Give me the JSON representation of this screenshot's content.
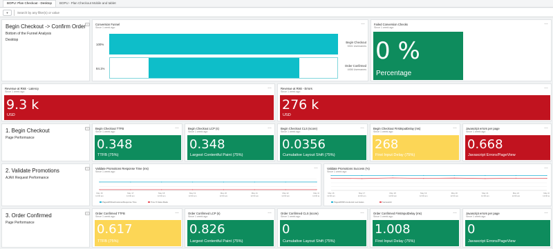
{
  "tabs": [
    {
      "label": "BOPU: Plan Checkout - Desktop",
      "active": true
    },
    {
      "label": "BOPU - Plan Checkout Mobile and tablet",
      "active": false
    }
  ],
  "filter": {
    "button_icon": "filter-icon",
    "placeholder": "Search by any filter(s) or value"
  },
  "sections": {
    "funnel": {
      "title": "Begin Checkout -> Confirm Order",
      "sub1": "Bottom of the Funnel Analysis",
      "sub2": "Desktop"
    },
    "begin": {
      "title": "1. Begin Checkout",
      "sub": "Page Performance"
    },
    "validate": {
      "title": "2. Validate Promotions",
      "sub": "AJAX Request Performance"
    },
    "confirmed": {
      "title": "3. Order Confirmed",
      "sub": "Page Performance"
    }
  },
  "conversion_funnel": {
    "title": "Conversion Funnel",
    "sub": "Since 1 week ago",
    "steps": [
      {
        "pct": "100%",
        "label": "Begin Checkout",
        "value": "5301 Usernames",
        "fraction": 1.0
      },
      {
        "pct": "84.1%",
        "label": "Order Confirmed",
        "value": "4456 Usernames",
        "fraction": 0.841
      }
    ]
  },
  "failed_checks": {
    "title": "Failed Conversion Checks",
    "sub": "Since 1 week ago",
    "value": "0 %",
    "label": "Percentage",
    "color": "#0e8c5d"
  },
  "revenue_latency": {
    "title": "Revenue at Risk - Latency",
    "sub": "Since 1 week ago",
    "value": "9.3 k",
    "label": "USD",
    "color": "#c1131f"
  },
  "revenue_errors": {
    "title": "Revenue at Risk - Errors",
    "sub": "Since 1 week ago",
    "value": "276 k",
    "label": "USD",
    "color": "#c1131f"
  },
  "begin_tiles": [
    {
      "title": "Begin Checkout TTFB",
      "sub": "Since 1 week ago",
      "value": "0.348",
      "label": "TTFB (75%)",
      "color": "#0e8c5d"
    },
    {
      "title": "Begin Checkout LCP (s)",
      "sub": "Since 1 week ago",
      "value": "0.348",
      "label": "Largest Contentful Paint (75%)",
      "color": "#0e8c5d"
    },
    {
      "title": "Begin Checkout CLS (score)",
      "sub": "Since 1 week ago",
      "value": "0.0356",
      "label": "Cumulative Layout Shift (75%)",
      "color": "#0e8c5d"
    },
    {
      "title": "Begin Checkout FirstInputDelay (ms)",
      "sub": "Since 1 week ago",
      "value": "268",
      "label": "First Input Delay (75%)",
      "color": "#fcd656"
    },
    {
      "title": "Javascript errors per page",
      "sub": "Since 1 week ago",
      "value": "0.668",
      "label": "Javascript Errors/PageView",
      "color": "#c1131f"
    }
  ],
  "confirmed_tiles": [
    {
      "title": "Order Confirmed TTFB",
      "sub": "Since 1 week ago",
      "value": "0.617",
      "label": "TTFB (75%)",
      "color": "#fcd656"
    },
    {
      "title": "Order Confirmed LCP (s)",
      "sub": "Since 1 week ago",
      "value": "0.826",
      "label": "Largest Contentful Paint (75%)",
      "color": "#0e8c5d"
    },
    {
      "title": "Order Confirmed CLS (score)",
      "sub": "Since 1 week ago",
      "value": "0",
      "label": "Cumulative Layout Shift (75%)",
      "color": "#0e8c5d"
    },
    {
      "title": "Order Confirmed FirstInputDelay (ms)",
      "sub": "Since 1 week ago",
      "value": "1.008",
      "label": "First Input Delay (75%)",
      "color": "#0e8c5d"
    },
    {
      "title": "Javascript errors per page",
      "sub": "Since 1 week ago",
      "value": "0",
      "label": "Javascript Errors/PageView",
      "color": "#0e8c5d"
    }
  ],
  "chart_data": [
    {
      "type": "line",
      "title": "Validate Promotions Response Time (ms)",
      "subtitle": "Since 1 week ago",
      "x": [
        "May 16, 12:00 am",
        "May 17, 12:00 am",
        "May 18, 12:00 am",
        "May 19, 12:00 am",
        "May 20, 12:00 am",
        "May 21, 12:00 am",
        "May 22, 12:00 am",
        "May 23, 12:00 am"
      ],
      "series": [
        {
          "name": "PagesWithGetCustomerResponse Time",
          "color": "#1fb2d5",
          "values": [
            0.55,
            0.55,
            0.55,
            0.55,
            0.55,
            0.55,
            0.55,
            0.55
          ]
        },
        {
          "name": "Time % Sales Made",
          "color": "#e8555f",
          "values": [
            0.05,
            0.05,
            0.05,
            0.05,
            0.05,
            0.05,
            0.05,
            0.05
          ]
        }
      ],
      "ylim": [
        0,
        1
      ]
    },
    {
      "type": "line",
      "title": "Validate Promotions Success (%)",
      "subtitle": "Since 1 week ago",
      "x": [
        "May 16, 12:00 am",
        "May 17, 12:00 am",
        "May 18, 12:00 am",
        "May 19, 12:00 am",
        "May 20, 12:00 am",
        "May 21, 12:00 am",
        "May 22, 12:00 am",
        "May 23, 12:00 am"
      ],
      "series": [
        {
          "name": "PagesWithPromotionsIn sed status",
          "color": "#1fb2d5",
          "values": [
            0.98,
            0.98,
            0.98,
            0.98,
            0.98,
            0.98,
            0.98,
            0.98
          ]
        },
        {
          "name": "Successful",
          "color": "#e8555f",
          "values": [
            0.8,
            0.78,
            0.82,
            0.79,
            0.81,
            0.78,
            0.8,
            0.79
          ]
        }
      ],
      "ylim": [
        0,
        1
      ]
    }
  ]
}
